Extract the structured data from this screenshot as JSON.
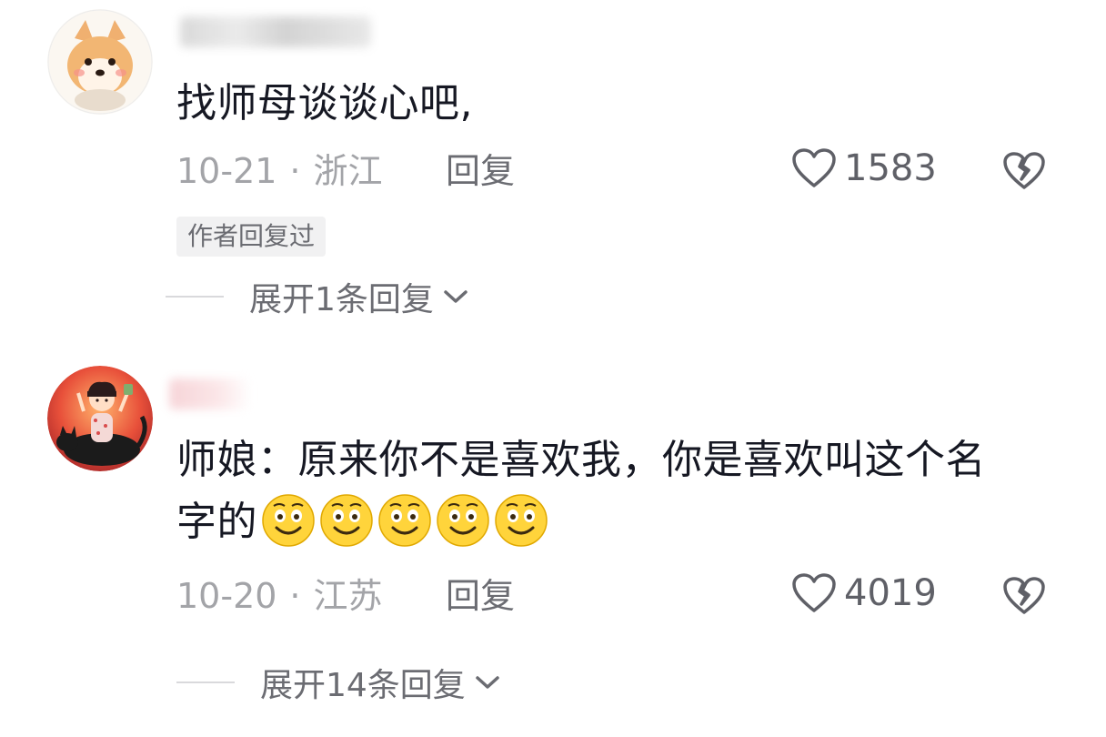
{
  "comments": [
    {
      "avatar_icon": "shiba-dog-avatar",
      "text": "找师母谈谈心吧,",
      "date": "10-21",
      "location": "浙江",
      "reply_label": "回复",
      "likes": "1583",
      "author_tag": "作者回复过",
      "expand_label": "展开1条回复"
    },
    {
      "avatar_icon": "girl-on-cat-avatar",
      "text": "师娘：原来你不是喜欢我，你是喜欢叫这个名字的",
      "text_line1": "师娘：原来你不是喜欢我，你是喜欢叫这个名",
      "text_line2": "字的",
      "emoji_icon": "smiling-face-emoji",
      "emoji_count": 5,
      "date": "10-20",
      "location": "江苏",
      "reply_label": "回复",
      "likes": "4019",
      "expand_label": "展开14条回复"
    }
  ],
  "colors": {
    "text": "#161823",
    "meta": "#a3a4a8",
    "action": "#6b6c72",
    "tag_bg": "#f1f1f2"
  }
}
